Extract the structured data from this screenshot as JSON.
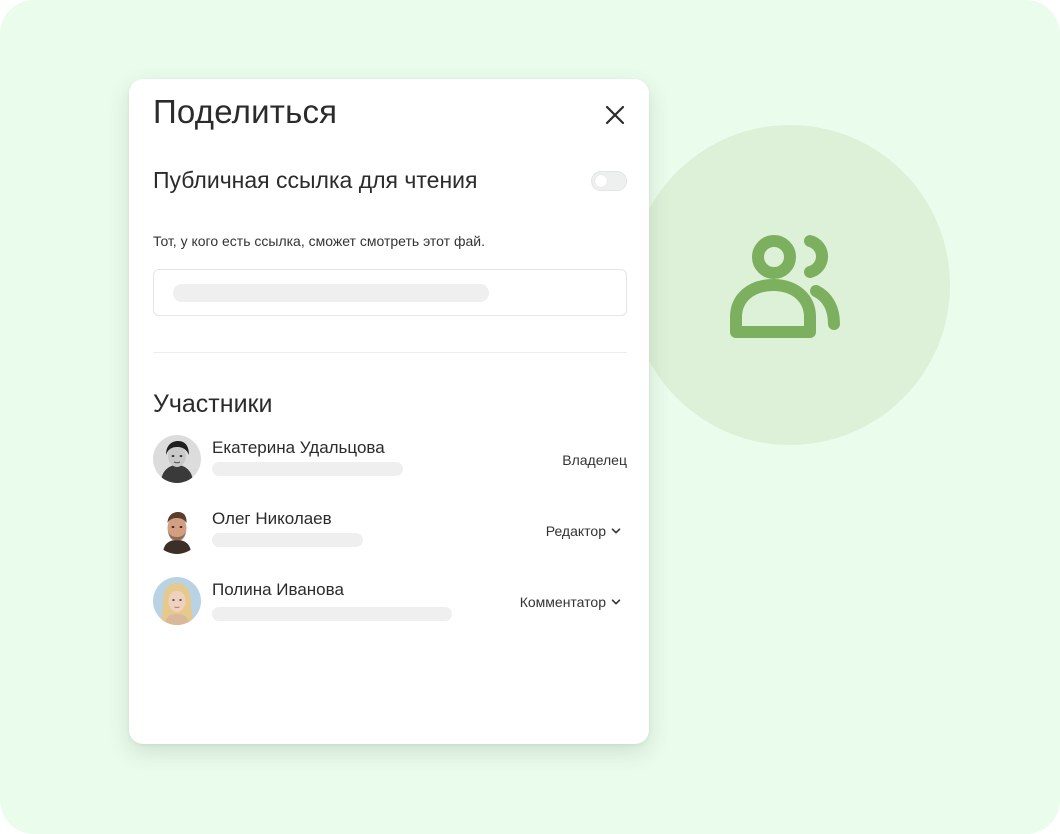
{
  "dialog": {
    "title": "Поделиться",
    "public_link": {
      "label": "Публичная ссылка для чтения",
      "enabled": false,
      "hint": "Тот, у кого есть ссылка, сможет смотреть этот фай."
    },
    "members_title": "Участники",
    "members": [
      {
        "name": "Екатерина Удальцова",
        "role": "Владелец",
        "role_editable": false
      },
      {
        "name": "Олег Николаев",
        "role": "Редактор",
        "role_editable": true
      },
      {
        "name": "Полина Иванова",
        "role": "Комментатор",
        "role_editable": true
      }
    ]
  },
  "colors": {
    "background": "#eafcec",
    "circle": "#ddf1d9",
    "accent_icon": "#7db05e",
    "dialog": "#ffffff"
  },
  "icons": {
    "close": "close-icon",
    "dropdown": "chevron-down-icon",
    "users": "users-icon"
  }
}
